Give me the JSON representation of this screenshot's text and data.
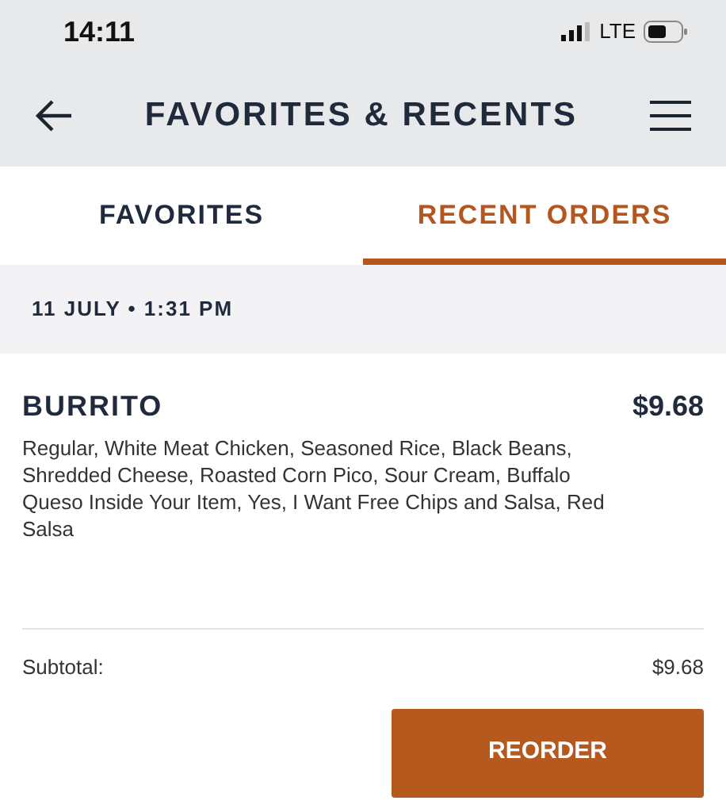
{
  "status_bar": {
    "time": "14:11",
    "network": "LTE"
  },
  "header": {
    "title": "FAVORITES & RECENTS"
  },
  "tabs": [
    {
      "label": "FAVORITES",
      "selected": false
    },
    {
      "label": "RECENT ORDERS",
      "selected": true
    }
  ],
  "orders": [
    {
      "date": "11 JULY • 1:31 PM",
      "item": "BURRITO",
      "price": "$9.68",
      "description": "Regular, White Meat Chicken, Seasoned Rice, Black Beans, Shredded Cheese, Roasted Corn Pico, Sour Cream, Buffalo Queso Inside Your Item, Yes, I Want Free Chips and Salsa, Red Salsa",
      "subtotal_label": "Subtotal:",
      "subtotal": "$9.68",
      "button": "REORDER"
    }
  ]
}
